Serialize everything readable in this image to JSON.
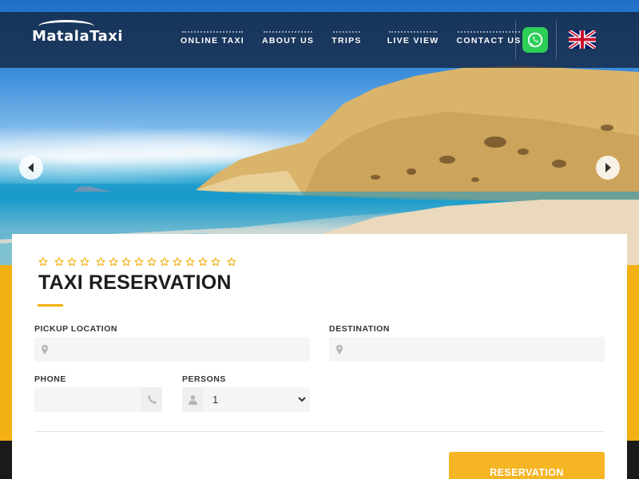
{
  "brand": {
    "logo_text": "MatalaTaxi"
  },
  "nav": {
    "items": [
      {
        "label": "ONLINE TAXI"
      },
      {
        "label": "ABOUT US"
      },
      {
        "label": "TRIPS"
      },
      {
        "label": "LIVE VIEW"
      },
      {
        "label": "CONTACT US"
      }
    ]
  },
  "icons": {
    "whatsapp": "whatsapp-icon",
    "language": "uk-flag-icon",
    "prev": "chevron-left-icon",
    "next": "chevron-right-icon",
    "location": "map-pin-icon",
    "phone": "phone-icon",
    "persons": "user-icon",
    "rating": "star-icon"
  },
  "colors": {
    "accent": "#f3b012",
    "nav_bg": "#14233c",
    "whatsapp": "#2ecf58"
  },
  "form": {
    "title": "TAXI RESERVATION",
    "stars_count": 15,
    "pickup": {
      "label": "PICKUP LOCATION",
      "value": "",
      "placeholder": ""
    },
    "destination": {
      "label": "DESTINATION",
      "value": "",
      "placeholder": ""
    },
    "phone": {
      "label": "PHONE",
      "value": "",
      "placeholder": ""
    },
    "persons": {
      "label": "PERSONS",
      "value": "1",
      "options": [
        "1"
      ]
    },
    "submit_label": "RESERVATION"
  }
}
